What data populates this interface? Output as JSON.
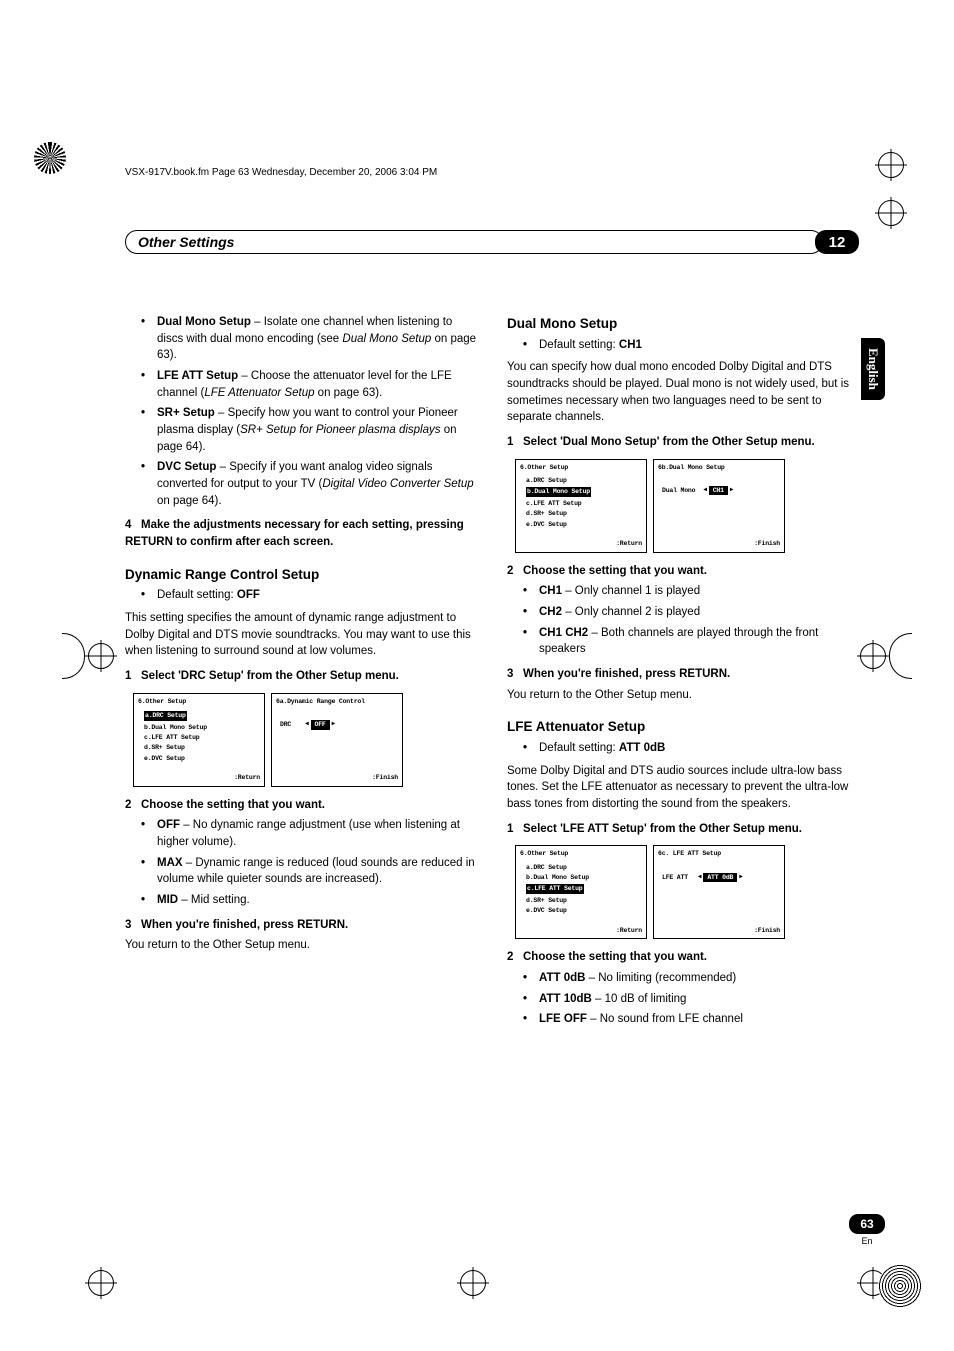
{
  "header_line": "VSX-917V.book.fm  Page 63  Wednesday, December 20, 2006  3:04 PM",
  "chapter_title": "Other Settings",
  "chapter_num": "12",
  "lang_tab": "English",
  "page_num": "63",
  "page_sub": "En",
  "col1": {
    "intro_bullets": [
      {
        "term": "Dual Mono Setup",
        "desc": " – Isolate one channel when listening to discs with dual mono encoding (see ",
        "ref": "Dual Mono Setup",
        "tail": " on page 63)."
      },
      {
        "term": "LFE ATT Setup",
        "desc": " – Choose the attenuator level for the LFE channel (",
        "ref": "LFE Attenuator Setup",
        "tail": " on page 63)."
      },
      {
        "term": "SR+ Setup",
        "desc": " – Specify how you want to control your Pioneer plasma display (",
        "ref": "SR+ Setup for Pioneer plasma displays",
        "tail": " on page 64)."
      },
      {
        "term": "DVC Setup",
        "desc": " – Specify if you want analog video signals converted for output to your TV (",
        "ref": "Digital Video Converter Setup",
        "tail": " on page 64)."
      }
    ],
    "step4": {
      "num": "4",
      "text": "Make the adjustments necessary for each setting, pressing RETURN to confirm after each screen."
    },
    "drc": {
      "title": "Dynamic Range Control Setup",
      "default_label": "Default setting: ",
      "default_val": "OFF",
      "desc": "This setting specifies the amount of dynamic range adjustment to Dolby Digital and DTS movie soundtracks. You may want to use this when listening to surround sound at low volumes.",
      "step1": {
        "num": "1",
        "text": "Select 'DRC Setup' from the Other Setup menu."
      },
      "screen_left": {
        "title": "6.Other Setup",
        "rows": [
          "a.DRC Setup",
          "b.Dual Mono Setup",
          "c.LFE ATT Setup",
          "d.SR+ Setup",
          "e.DVC Setup"
        ],
        "hl": 0,
        "footer": ":Return"
      },
      "screen_right": {
        "title": "6a.Dynamic Range Control",
        "label": "DRC",
        "value": "OFF",
        "footer": ":Finish"
      },
      "step2": {
        "num": "2",
        "text": "Choose the setting that you want."
      },
      "opts": [
        {
          "term": "OFF",
          "desc": " – No dynamic range adjustment (use when listening at higher volume)."
        },
        {
          "term": "MAX",
          "desc": " – Dynamic range is reduced (loud sounds are reduced in volume while quieter sounds are increased)."
        },
        {
          "term": "MID",
          "desc": " – Mid setting."
        }
      ],
      "step3": {
        "num": "3",
        "text": "When you're finished, press RETURN."
      },
      "after": "You return to the Other Setup menu."
    }
  },
  "col2": {
    "dual": {
      "title": "Dual Mono Setup",
      "default_label": "Default setting: ",
      "default_val": "CH1",
      "desc": "You can specify how dual mono encoded Dolby Digital and DTS soundtracks should be played. Dual mono is not widely used, but is sometimes necessary when two languages need to be sent to separate channels.",
      "step1": {
        "num": "1",
        "text": "Select 'Dual Mono Setup' from the Other Setup menu."
      },
      "screen_left": {
        "title": "6.Other Setup",
        "rows": [
          "a.DRC Setup",
          "b.Dual Mono Setup",
          "c.LFE ATT Setup",
          "d.SR+ Setup",
          "e.DVC Setup"
        ],
        "hl": 1,
        "footer": ":Return"
      },
      "screen_right": {
        "title": "6b.Dual Mono Setup",
        "label": "Dual Mono",
        "value": "CH1",
        "footer": ":Finish"
      },
      "step2": {
        "num": "2",
        "text": "Choose the setting that you want."
      },
      "opts": [
        {
          "term": "CH1",
          "desc": " – Only channel 1 is played"
        },
        {
          "term": "CH2",
          "desc": " – Only channel 2 is played"
        },
        {
          "term": "CH1 CH2",
          "desc": " – Both channels are played through the front speakers"
        }
      ],
      "step3": {
        "num": "3",
        "text": "When you're finished, press RETURN."
      },
      "after": "You return to the Other Setup menu."
    },
    "lfe": {
      "title": "LFE Attenuator Setup",
      "default_label": "Default setting: ",
      "default_val": "ATT 0dB",
      "desc": "Some Dolby Digital and DTS audio sources include ultra-low bass tones. Set the LFE attenuator as necessary to prevent the ultra-low bass tones from distorting the sound from the speakers.",
      "step1": {
        "num": "1",
        "text": "Select 'LFE ATT Setup' from the Other Setup menu."
      },
      "screen_left": {
        "title": "6.Other Setup",
        "rows": [
          "a.DRC Setup",
          "b.Dual Mono Setup",
          "c.LFE ATT Setup",
          "d.SR+ Setup",
          "e.DVC Setup"
        ],
        "hl": 2,
        "footer": ":Return"
      },
      "screen_right": {
        "title": "6c. LFE ATT Setup",
        "label": "LFE ATT",
        "value": "ATT 0dB",
        "footer": ":Finish"
      },
      "step2": {
        "num": "2",
        "text": "Choose the setting that you want."
      },
      "opts": [
        {
          "term": "ATT 0dB",
          "desc": " – No limiting (recommended)"
        },
        {
          "term": "ATT 10dB",
          "desc": " – 10 dB of limiting"
        },
        {
          "term": "LFE OFF",
          "desc": " – No sound from LFE channel"
        }
      ]
    }
  }
}
